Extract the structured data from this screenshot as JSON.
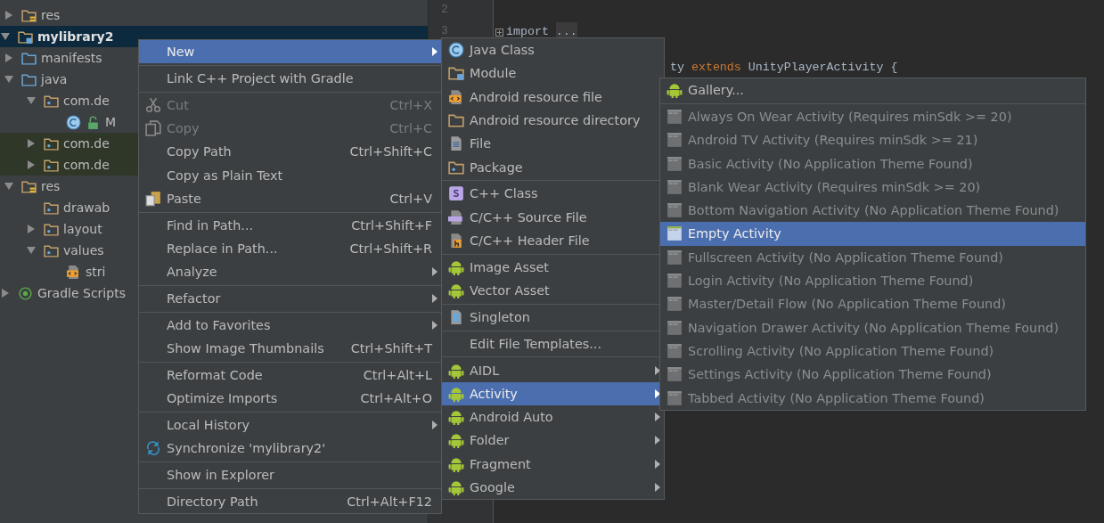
{
  "project_tree": [
    {
      "children": [
        {
          "label": "res",
          "kind": "res-folder",
          "expanded": false,
          "selected": false,
          "marked": false
        }
      ]
    },
    {
      "label": "mylibrary2",
      "kind": "module",
      "expanded": true,
      "selected": true,
      "marked": false,
      "children": [
        {
          "label": "manifests",
          "kind": "source-folder",
          "expanded": false,
          "selected": false,
          "marked": false
        },
        {
          "label": "java",
          "kind": "source-folder",
          "expanded": true,
          "selected": false,
          "marked": false,
          "children": [
            {
              "label": "com.de",
              "kind": "package",
              "expanded": true,
              "selected": false,
              "marked": false,
              "children": [
                {
                  "label": "M",
                  "kind": "class",
                  "selected": false,
                  "marked": false
                }
              ]
            },
            {
              "label": "com.de",
              "kind": "package",
              "expanded": false,
              "selected": false,
              "marked": true
            },
            {
              "label": "com.de",
              "kind": "package",
              "expanded": false,
              "selected": false,
              "marked": true
            }
          ]
        },
        {
          "label": "res",
          "kind": "res-folder",
          "expanded": true,
          "selected": false,
          "marked": false,
          "children": [
            {
              "label": "drawab",
              "kind": "package",
              "selected": false,
              "marked": false
            },
            {
              "label": "layout",
              "kind": "package",
              "expanded": false,
              "selected": false,
              "marked": false
            },
            {
              "label": "values",
              "kind": "package",
              "expanded": true,
              "selected": false,
              "marked": false,
              "children": [
                {
                  "label": "stri",
                  "kind": "xml",
                  "selected": false,
                  "marked": false
                }
              ]
            }
          ]
        }
      ]
    },
    {
      "label": "Gradle Scripts",
      "kind": "gradle",
      "expanded": false,
      "selected": false,
      "marked": false
    }
  ],
  "editor": {
    "lines": [
      {
        "kind": "numbered",
        "number": "2"
      },
      {
        "kind": "numbered",
        "number": "3",
        "folded": true,
        "tokens": [
          {
            "kind": "plain",
            "text": "import "
          },
          {
            "kind": "fold",
            "text": "..."
          }
        ]
      },
      {
        "kind": "covered",
        "tokens": [
          {
            "kind": "plain",
            "text": "ty "
          },
          {
            "kind": "keyword",
            "text": "extends"
          },
          {
            "kind": "plain",
            "text": " UnityPlayerActivity {"
          }
        ]
      }
    ]
  },
  "context_menu": {
    "items": [
      {
        "kind": "item",
        "label": "New",
        "submenu": true,
        "selected": true,
        "disabled": false
      },
      {
        "kind": "separator"
      },
      {
        "kind": "item",
        "label": "Link C++ Project with Gradle",
        "submenu": false,
        "selected": false,
        "disabled": false
      },
      {
        "kind": "separator"
      },
      {
        "kind": "scissors",
        "label": "Cut",
        "shortcut": "Ctrl+X",
        "submenu": false,
        "selected": false,
        "disabled": true
      },
      {
        "kind": "copy",
        "label": "Copy",
        "shortcut": "Ctrl+C",
        "submenu": false,
        "selected": false,
        "disabled": true
      },
      {
        "kind": "item",
        "label": "Copy Path",
        "shortcut": "Ctrl+Shift+C",
        "submenu": false,
        "selected": false,
        "disabled": false
      },
      {
        "kind": "item",
        "label": "Copy as Plain Text",
        "submenu": false,
        "selected": false,
        "disabled": false
      },
      {
        "kind": "paste",
        "label": "Paste",
        "shortcut": "Ctrl+V",
        "submenu": false,
        "selected": false,
        "disabled": false
      },
      {
        "kind": "separator"
      },
      {
        "kind": "item",
        "label": "Find in Path...",
        "shortcut": "Ctrl+Shift+F",
        "submenu": false,
        "selected": false,
        "disabled": false
      },
      {
        "kind": "item",
        "label": "Replace in Path...",
        "shortcut": "Ctrl+Shift+R",
        "submenu": false,
        "selected": false,
        "disabled": false
      },
      {
        "kind": "item",
        "label": "Analyze",
        "submenu": true,
        "selected": false,
        "disabled": false
      },
      {
        "kind": "separator"
      },
      {
        "kind": "item",
        "label": "Refactor",
        "submenu": true,
        "selected": false,
        "disabled": false
      },
      {
        "kind": "separator"
      },
      {
        "kind": "item",
        "label": "Add to Favorites",
        "submenu": true,
        "selected": false,
        "disabled": false
      },
      {
        "kind": "item",
        "label": "Show Image Thumbnails",
        "shortcut": "Ctrl+Shift+T",
        "submenu": false,
        "selected": false,
        "disabled": false
      },
      {
        "kind": "separator"
      },
      {
        "kind": "item",
        "label": "Reformat Code",
        "shortcut": "Ctrl+Alt+L",
        "submenu": false,
        "selected": false,
        "disabled": false
      },
      {
        "kind": "item",
        "label": "Optimize Imports",
        "shortcut": "Ctrl+Alt+O",
        "submenu": false,
        "selected": false,
        "disabled": false
      },
      {
        "kind": "separator"
      },
      {
        "kind": "item",
        "label": "Local History",
        "submenu": true,
        "selected": false,
        "disabled": false
      },
      {
        "kind": "sync",
        "label": "Synchronize 'mylibrary2'",
        "submenu": false,
        "selected": false,
        "disabled": false
      },
      {
        "kind": "separator"
      },
      {
        "kind": "item",
        "label": "Show in Explorer",
        "submenu": false,
        "selected": false,
        "disabled": false
      },
      {
        "kind": "separator"
      },
      {
        "kind": "item",
        "label": "Directory Path",
        "shortcut": "Ctrl+Alt+F12",
        "submenu": false,
        "selected": false,
        "disabled": false
      }
    ]
  },
  "new_submenu": {
    "items": [
      {
        "kind": "class",
        "label": "Java Class",
        "submenu": false,
        "selected": false,
        "disabled": false
      },
      {
        "kind": "module",
        "label": "Module",
        "submenu": false,
        "selected": false,
        "disabled": false
      },
      {
        "kind": "resource-file",
        "label": "Android resource file",
        "submenu": false,
        "selected": false,
        "disabled": false
      },
      {
        "kind": "folder",
        "label": "Android resource directory",
        "submenu": false,
        "selected": false,
        "disabled": false
      },
      {
        "kind": "file",
        "label": "File",
        "submenu": false,
        "selected": false,
        "disabled": false
      },
      {
        "kind": "package",
        "label": "Package",
        "submenu": false,
        "selected": false,
        "disabled": false
      },
      {
        "kind": "separator"
      },
      {
        "kind": "cpp-class",
        "label": "C++ Class",
        "submenu": false,
        "selected": false,
        "disabled": false
      },
      {
        "kind": "cpp-source",
        "label": "C/C++ Source File",
        "submenu": false,
        "selected": false,
        "disabled": false
      },
      {
        "kind": "header",
        "label": "C/C++ Header File",
        "submenu": false,
        "selected": false,
        "disabled": false
      },
      {
        "kind": "separator"
      },
      {
        "kind": "android",
        "label": "Image Asset",
        "submenu": false,
        "selected": false,
        "disabled": false
      },
      {
        "kind": "android",
        "label": "Vector Asset",
        "submenu": false,
        "selected": false,
        "disabled": false
      },
      {
        "kind": "separator"
      },
      {
        "kind": "singleton",
        "label": "Singleton",
        "submenu": false,
        "selected": false,
        "disabled": false
      },
      {
        "kind": "separator"
      },
      {
        "kind": "item",
        "label": "Edit File Templates...",
        "submenu": false,
        "selected": false,
        "disabled": false
      },
      {
        "kind": "separator"
      },
      {
        "kind": "android",
        "label": "AIDL",
        "submenu": true,
        "selected": false,
        "disabled": false
      },
      {
        "kind": "android",
        "label": "Activity",
        "submenu": true,
        "selected": true,
        "disabled": false
      },
      {
        "kind": "android",
        "label": "Android Auto",
        "submenu": true,
        "selected": false,
        "disabled": false
      },
      {
        "kind": "android",
        "label": "Folder",
        "submenu": true,
        "selected": false,
        "disabled": false
      },
      {
        "kind": "android",
        "label": "Fragment",
        "submenu": true,
        "selected": false,
        "disabled": false
      },
      {
        "kind": "android",
        "label": "Google",
        "submenu": true,
        "selected": false,
        "disabled": false
      }
    ]
  },
  "activity_submenu": {
    "items": [
      {
        "kind": "android",
        "label": "Gallery...",
        "submenu": false,
        "selected": false,
        "disabled": false
      },
      {
        "kind": "separator"
      },
      {
        "kind": "template",
        "label": "Always On Wear Activity (Requires minSdk >= 20)",
        "submenu": false,
        "selected": false,
        "disabled": true
      },
      {
        "kind": "template",
        "label": "Android TV Activity (Requires minSdk >= 21)",
        "submenu": false,
        "selected": false,
        "disabled": true
      },
      {
        "kind": "template",
        "label": "Basic Activity (No Application Theme Found)",
        "submenu": false,
        "selected": false,
        "disabled": true
      },
      {
        "kind": "template",
        "label": "Blank Wear Activity (Requires minSdk >= 20)",
        "submenu": false,
        "selected": false,
        "disabled": true
      },
      {
        "kind": "template",
        "label": "Bottom Navigation Activity (No Application Theme Found)",
        "submenu": false,
        "selected": false,
        "disabled": true
      },
      {
        "kind": "template",
        "label": "Empty Activity",
        "submenu": false,
        "selected": true,
        "disabled": false
      },
      {
        "kind": "template",
        "label": "Fullscreen Activity (No Application Theme Found)",
        "submenu": false,
        "selected": false,
        "disabled": true
      },
      {
        "kind": "template",
        "label": "Login Activity (No Application Theme Found)",
        "submenu": false,
        "selected": false,
        "disabled": true
      },
      {
        "kind": "template",
        "label": "Master/Detail Flow (No Application Theme Found)",
        "submenu": false,
        "selected": false,
        "disabled": true
      },
      {
        "kind": "template",
        "label": "Navigation Drawer Activity (No Application Theme Found)",
        "submenu": false,
        "selected": false,
        "disabled": true
      },
      {
        "kind": "template",
        "label": "Scrolling Activity (No Application Theme Found)",
        "submenu": false,
        "selected": false,
        "disabled": true
      },
      {
        "kind": "template",
        "label": "Settings Activity (No Application Theme Found)",
        "submenu": false,
        "selected": false,
        "disabled": true
      },
      {
        "kind": "template",
        "label": "Tabbed Activity (No Application Theme Found)",
        "submenu": false,
        "selected": false,
        "disabled": true
      }
    ]
  }
}
